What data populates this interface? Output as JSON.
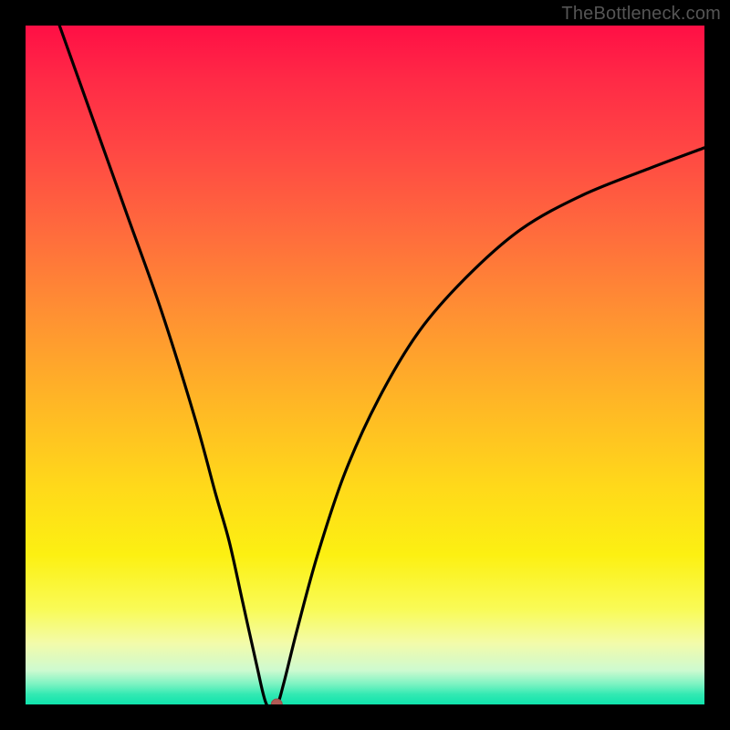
{
  "watermark": "TheBottleneck.com",
  "chart_data": {
    "type": "line",
    "title": "",
    "xlabel": "",
    "ylabel": "",
    "xlim": [
      0,
      100
    ],
    "ylim": [
      0,
      100
    ],
    "grid": false,
    "legend": false,
    "background": "rainbow-red-to-green-vertical",
    "series": [
      {
        "name": "bottleneck-curve",
        "color": "#000000",
        "x": [
          5,
          10,
          15,
          20,
          25,
          28,
          30,
          32,
          34,
          35.5,
          37,
          38,
          40,
          43,
          47,
          52,
          58,
          65,
          73,
          82,
          92,
          100
        ],
        "y": [
          100,
          86,
          72,
          58,
          42,
          31,
          24,
          15,
          6,
          0,
          0,
          3,
          11,
          22,
          34,
          45,
          55,
          63,
          70,
          75,
          79,
          82
        ]
      }
    ],
    "annotations": [
      {
        "type": "point",
        "x": 37,
        "y": 0,
        "color": "#b15a55",
        "radius_px": 6
      }
    ]
  }
}
